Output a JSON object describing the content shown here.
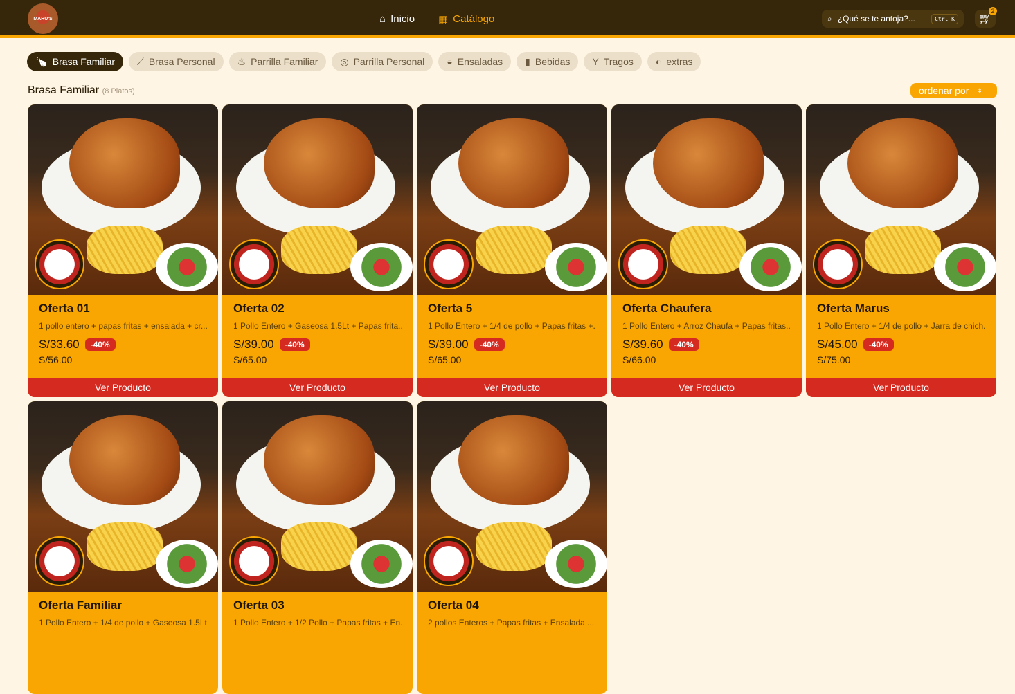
{
  "header": {
    "logo_text": "MARU'S",
    "nav": [
      {
        "label": "Inicio",
        "icon": "home-icon"
      },
      {
        "label": "Catálogo",
        "icon": "grid-icon"
      }
    ],
    "search_placeholder": "¿Qué se te antoja?...",
    "shortcut": "Ctrl K",
    "cart_count": "2"
  },
  "categories": [
    {
      "label": "Brasa Familiar",
      "active": true
    },
    {
      "label": "Brasa Personal"
    },
    {
      "label": "Parrilla Familiar"
    },
    {
      "label": "Parrilla Personal"
    },
    {
      "label": "Ensaladas"
    },
    {
      "label": "Bebidas"
    },
    {
      "label": "Tragos"
    },
    {
      "label": "extras"
    }
  ],
  "section": {
    "title": "Brasa Familiar",
    "count": "(8 Platos)",
    "sort_label": "ordenar por"
  },
  "products": [
    {
      "name": "Oferta 01",
      "desc": "1 pollo entero + papas fritas + ensalada + cr...",
      "price": "S/33.60",
      "discount": "-40%",
      "old_price": "S/56.00",
      "button": "Ver Producto"
    },
    {
      "name": "Oferta 02",
      "desc": "1 Pollo Entero + Gaseosa 1.5Lt + Papas frita...",
      "price": "S/39.00",
      "discount": "-40%",
      "old_price": "S/65.00",
      "button": "Ver Producto"
    },
    {
      "name": "Oferta 5",
      "desc": "1 Pollo Entero + 1/4 de pollo + Papas fritas +...",
      "price": "S/39.00",
      "discount": "-40%",
      "old_price": "S/65.00",
      "button": "Ver Producto"
    },
    {
      "name": "Oferta Chaufera",
      "desc": "1 Pollo Entero + Arroz Chaufa + Papas fritas...",
      "price": "S/39.60",
      "discount": "-40%",
      "old_price": "S/66.00",
      "button": "Ver Producto"
    },
    {
      "name": "Oferta Marus",
      "desc": "1 Pollo Entero + 1/4 de pollo + Jarra de chich...",
      "price": "S/45.00",
      "discount": "-40%",
      "old_price": "S/75.00",
      "button": "Ver Producto"
    },
    {
      "name": "Oferta Familiar",
      "desc": "1 Pollo Entero + 1/4 de pollo + Gaseosa 1.5Lt...",
      "price": "",
      "discount": "",
      "old_price": "",
      "button": ""
    },
    {
      "name": "Oferta 03",
      "desc": "1 Pollo Entero + 1/2 Pollo + Papas fritas + En...",
      "price": "",
      "discount": "",
      "old_price": "",
      "button": ""
    },
    {
      "name": "Oferta 04",
      "desc": "2 pollos Enteros + Papas fritas + Ensalada ...",
      "price": "",
      "discount": "",
      "old_price": "",
      "button": ""
    }
  ],
  "colors": {
    "header": "#36270a",
    "accent": "#f9a602",
    "button": "#d52a20",
    "background": "#fff5e4"
  }
}
